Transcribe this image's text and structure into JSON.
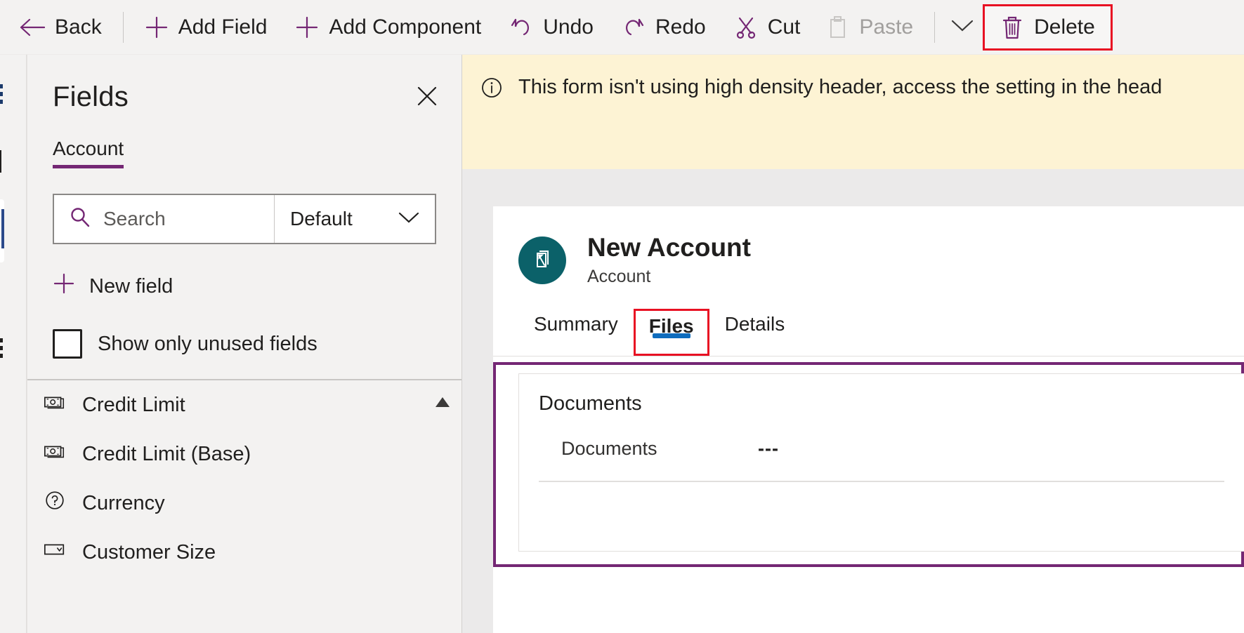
{
  "toolbar": {
    "back": {
      "label": "Back",
      "icon": "arrow-left-icon"
    },
    "add_field": {
      "label": "Add Field",
      "icon": "plus-icon"
    },
    "add_component": {
      "label": "Add Component",
      "icon": "plus-icon"
    },
    "undo": {
      "label": "Undo",
      "icon": "undo-icon"
    },
    "redo": {
      "label": "Redo",
      "icon": "redo-icon"
    },
    "cut": {
      "label": "Cut",
      "icon": "scissors-icon"
    },
    "paste": {
      "label": "Paste",
      "icon": "clipboard-icon",
      "state": "disabled"
    },
    "overflow": {
      "icon": "chevron-down-icon"
    },
    "delete": {
      "label": "Delete",
      "icon": "trash-icon",
      "highlight_color": "#e81123"
    }
  },
  "fields_panel": {
    "title": "Fields",
    "close_icon": "close-icon",
    "tabs": [
      {
        "label": "Account",
        "active": true
      }
    ],
    "search": {
      "placeholder": "Search",
      "value": "",
      "icon": "search-icon"
    },
    "filter": {
      "value": "Default",
      "icon": "chevron-down-icon"
    },
    "new_field": {
      "label": "New field",
      "icon": "plus-icon"
    },
    "show_unused": {
      "label": "Show only unused fields",
      "checked": false
    },
    "scroll_up_icon": "triangle-up-icon",
    "items": [
      {
        "label": "Credit Limit",
        "icon": "currency-icon"
      },
      {
        "label": "Credit Limit (Base)",
        "icon": "currency-icon"
      },
      {
        "label": "Currency",
        "icon": "lookup-icon"
      },
      {
        "label": "Customer Size",
        "icon": "optionset-icon"
      }
    ]
  },
  "notification": {
    "icon": "info-icon",
    "text": "This form isn't using high density header, access the setting in the head"
  },
  "form": {
    "record_icon": "account-entity-icon",
    "record_icon_color": "#0b6169",
    "title": "New Account",
    "subtitle": "Account",
    "tabs": [
      {
        "label": "Summary",
        "active": false,
        "outlined": false
      },
      {
        "label": "Files",
        "active": true,
        "outlined": true
      },
      {
        "label": "Details",
        "active": false,
        "outlined": false
      }
    ],
    "section": {
      "selected_border_color": "#742774",
      "title": "Documents",
      "field_label": "Documents",
      "field_value": "---"
    }
  }
}
